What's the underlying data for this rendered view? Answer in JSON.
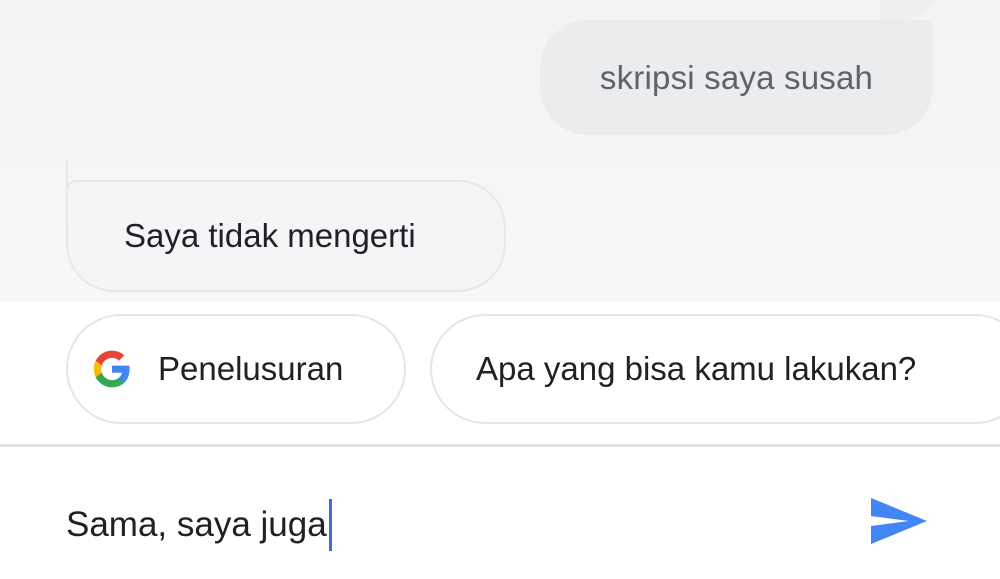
{
  "conversation": {
    "user_message": "skripsi saya susah",
    "assistant_message": "Saya tidak mengerti"
  },
  "suggestions": {
    "search_chip_label": "Penelusuran",
    "search_chip_icon": "google-g-icon",
    "capabilities_chip_label": "Apa yang bisa kamu lakukan?"
  },
  "input": {
    "value": "Sama, saya juga",
    "send_icon": "send-icon"
  },
  "colors": {
    "accent": "#4285f4",
    "caret": "#3b6fd6",
    "user_bubble": "#eaecee",
    "chat_background": "#f3f4f5"
  }
}
